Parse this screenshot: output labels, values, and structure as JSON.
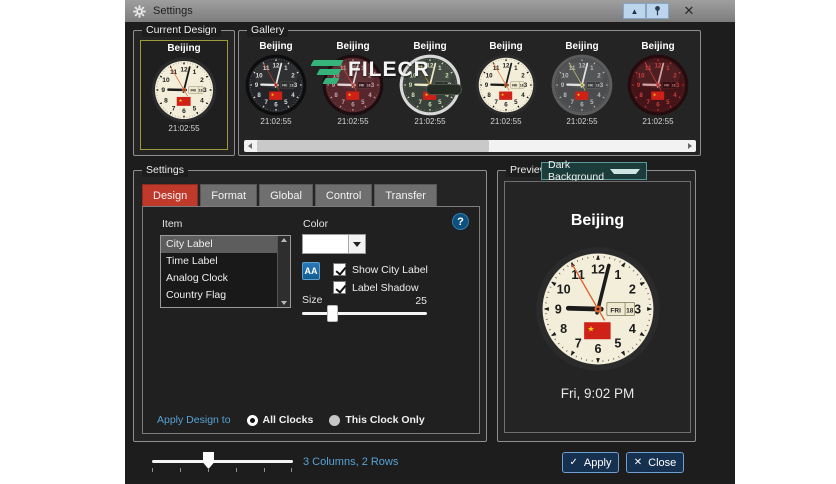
{
  "window": {
    "title": "Settings",
    "rollup_icon": "▲",
    "close_icon": "✕"
  },
  "theme": {
    "dialog_bg": "#1d1d1d",
    "group_bg": "#242424",
    "group_border": "#8f8f8f",
    "accent_blue": "#57a3d6",
    "tab_active_bg": "#c03a2c",
    "tab_inactive_bg": "#6f6f6f",
    "selection_bg": "#5d5d5d",
    "button_bg": "#16304f",
    "button_border": "#6f9fd0",
    "tile_selected_border": "#9c9c3f"
  },
  "current_design": {
    "label": "Current Design",
    "city": "Beijing",
    "time": "21:02:55",
    "variant": "cream"
  },
  "gallery": {
    "label": "Gallery",
    "items": [
      {
        "city": "Beijing",
        "time": "21:02:55",
        "variant": "black"
      },
      {
        "city": "Beijing",
        "time": "21:02:55",
        "variant": "maroon"
      },
      {
        "city": "Beijing",
        "time": "21:02:55",
        "variant": "silver"
      },
      {
        "city": "Beijing",
        "time": "21:02:55",
        "variant": "cream"
      },
      {
        "city": "Beijing",
        "time": "21:02:55",
        "variant": "gray"
      },
      {
        "city": "Beijing",
        "time": "21:02:55",
        "variant": "darkred"
      }
    ]
  },
  "settings": {
    "label": "Settings",
    "tabs": [
      {
        "label": "Design",
        "active": true
      },
      {
        "label": "Format",
        "active": false
      },
      {
        "label": "Global",
        "active": false
      },
      {
        "label": "Control",
        "active": false
      },
      {
        "label": "Transfer",
        "active": false
      }
    ],
    "item_label": "Item",
    "items": [
      {
        "label": "City Label",
        "selected": true
      },
      {
        "label": "Time Label",
        "selected": false
      },
      {
        "label": "Analog Clock",
        "selected": false
      },
      {
        "label": "Country Flag",
        "selected": false
      }
    ],
    "color_label": "Color",
    "color_value": "#ffffff",
    "font_button_label": "AA",
    "help_label": "?",
    "checkboxes": [
      {
        "label": "Show City Label",
        "checked": true
      },
      {
        "label": "Label Shadow",
        "checked": true
      }
    ],
    "size_label": "Size",
    "size_value": "25",
    "apply_design_label": "Apply Design to",
    "radios": [
      {
        "label": "All Clocks",
        "selected": true
      },
      {
        "label": "This Clock Only",
        "selected": false
      }
    ]
  },
  "preview": {
    "label": "Preview",
    "background_option": "Dark Background",
    "city": "Beijing",
    "datetime": "Fri, 9:02 PM",
    "variant": "cream"
  },
  "footer": {
    "grid_text": "3 Columns, 2 Rows",
    "apply_icon": "✓",
    "apply_label": "Apply",
    "close_icon": "✕",
    "close_label": "Close"
  },
  "watermark": {
    "text": "FILECR"
  },
  "clock": {
    "date_label": "FRI 18",
    "hands": {
      "hour": 271.5,
      "minute": 14,
      "second": 330
    },
    "flag": {
      "bg": "#cf2118",
      "star": "#f7d117"
    },
    "variants": {
      "cream": {
        "rim": "#2b2b2b",
        "face": "#f2eed9",
        "num": "#1b1b1b",
        "tick": "#1b1b1b",
        "hand": "#1b1b1b",
        "second": "#e2622f",
        "dw_bg": "#efe9cf",
        "dw_fg": "#222222",
        "dw_border": "#8a8a6a"
      },
      "black": {
        "rim": "#0d0d0d",
        "face": "#232528",
        "num": "#dcdcdc",
        "tick": "#cfcfcf",
        "hand": "#e6e6e6",
        "second": "#d04838",
        "dw_bg": "#2e2e2e",
        "dw_fg": "#cccccc",
        "dw_border": "#555555"
      },
      "maroon": {
        "rim": "#1c0d10",
        "face": "#55262b",
        "num": "#c5a3a6",
        "tick": "#b89598",
        "hand": "#e0d8d8",
        "second": "#e05545",
        "dw_bg": "#3a1c20",
        "dw_fg": "#d8c0c0",
        "dw_border": "#6a4448"
      },
      "silver": {
        "rim": "#d9d9d9",
        "face": "#39413a",
        "num": "#cfe3b6",
        "tick": "#c2d6aa",
        "hand": "#ece9c8",
        "second": "#d8a020",
        "dw_bg": "#2c332c",
        "dw_fg": "#d8e6c0",
        "dw_border": "#6a7a6a"
      },
      "gray": {
        "rim": "#5c5c5c",
        "face": "#4a4c4e",
        "num": "#b9bbbd",
        "tick": "#aaacae",
        "hand": "#e2e2e2",
        "second": "#d6d068",
        "dw_bg": "#3a3c3e",
        "dw_fg": "#cccccc",
        "dw_border": "#707070"
      },
      "darkred": {
        "rim": "#240c0e",
        "face": "#441418",
        "num": "#cc3f3a",
        "tick": "#b03a36",
        "hand": "#d6a0a0",
        "second": "#e04840",
        "dw_bg": "#321012",
        "dw_fg": "#cc8888",
        "dw_border": "#5a2a2a"
      }
    }
  }
}
